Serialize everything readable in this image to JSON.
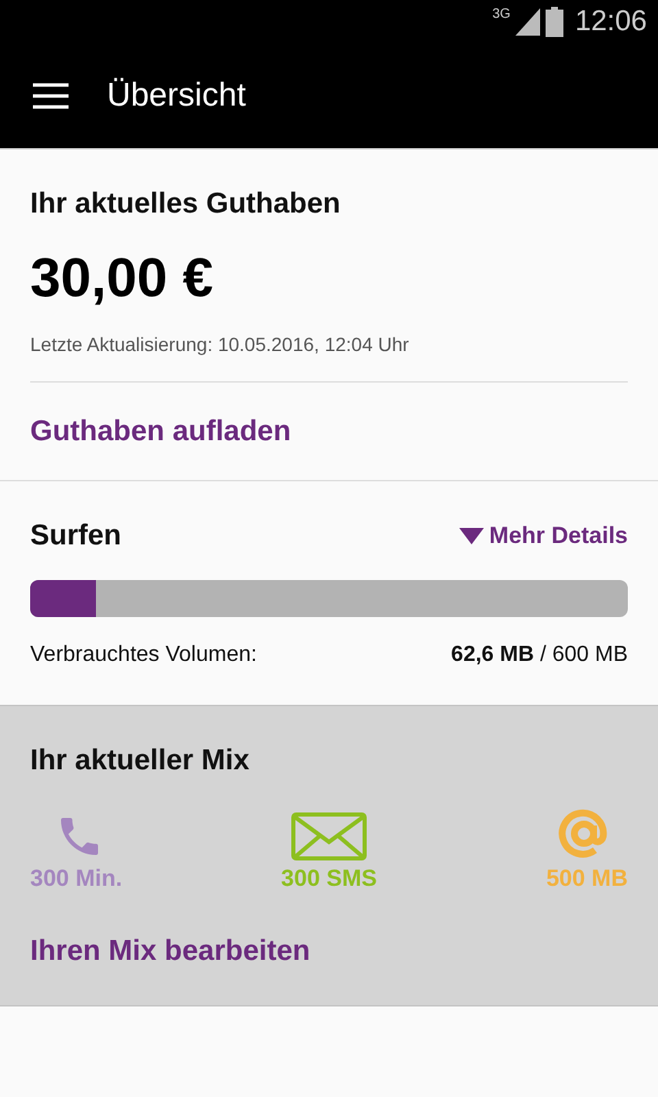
{
  "status_bar": {
    "network": "3G",
    "time": "12:06"
  },
  "toolbar": {
    "title": "Übersicht"
  },
  "balance": {
    "heading": "Ihr aktuelles Guthaben",
    "amount": "30,00 €",
    "updated": "Letzte Aktualisierung: 10.05.2016, 12:04 Uhr",
    "link": "Guthaben aufladen"
  },
  "surfen": {
    "heading": "Surfen",
    "details": "Mehr Details",
    "level": 0.11,
    "label": "Verbrauchtes Volumen:",
    "reading": "**62,6 MB** / 600 MB"
  },
  "mix": {
    "heading": "Ihr aktueller Mix",
    "items": [
      {
        "kind": "phone",
        "label": "300 Min.",
        "color": "#a486bf"
      },
      {
        "kind": "sms",
        "label": "300 SMS",
        "color": "#8dbf1f"
      },
      {
        "kind": "data",
        "label": "500 MB",
        "color": "#f2b13e"
      }
    ],
    "link": "Ihren Mix bearbeiten"
  }
}
